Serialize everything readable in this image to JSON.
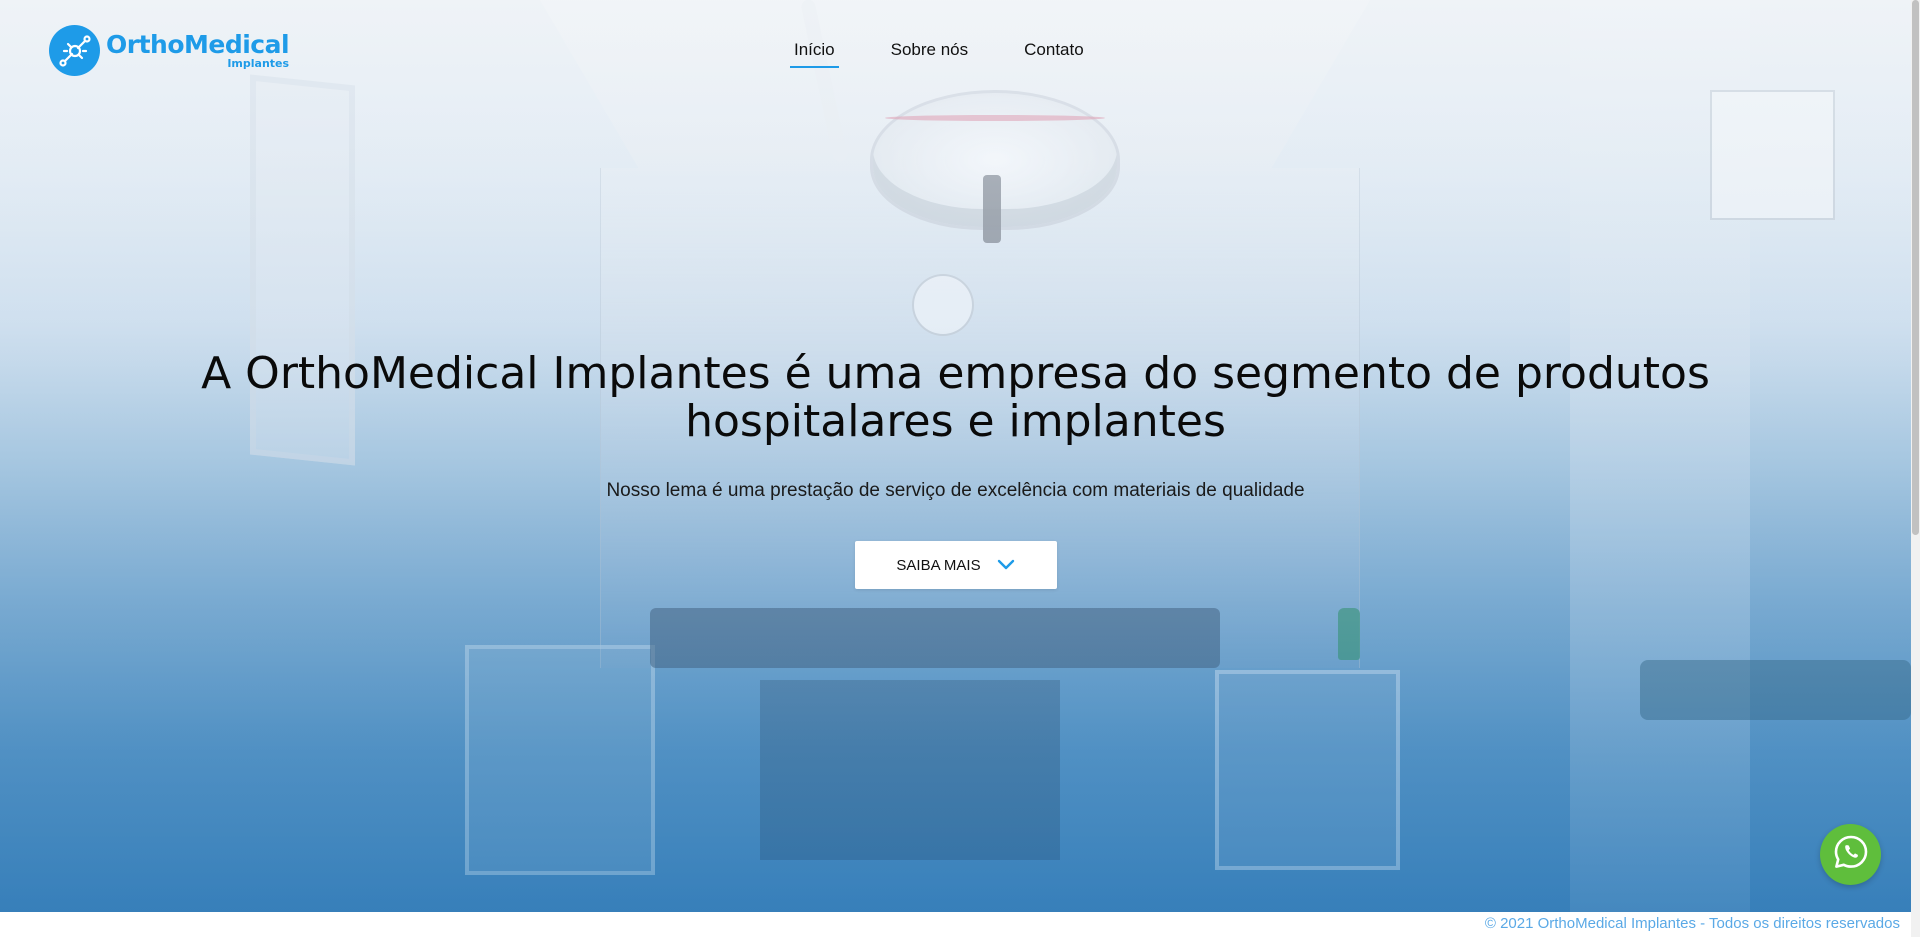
{
  "brand": {
    "name": "OrthoMedical",
    "sub": "Implantes",
    "color": "#1e9be8"
  },
  "nav": {
    "items": [
      {
        "label": "Início",
        "active": true
      },
      {
        "label": "Sobre nós",
        "active": false
      },
      {
        "label": "Contato",
        "active": false
      }
    ]
  },
  "hero": {
    "title": "A OrthoMedical Implantes é uma empresa do segmento de produtos hospitalares e implantes",
    "subtitle": "Nosso lema é uma prestação de serviço de excelência com materiais de qualidade",
    "cta_label": "SAIBA MAIS",
    "cta_icon": "chevron-down-icon"
  },
  "whatsapp": {
    "icon": "whatsapp-icon",
    "color": "#5fbe3c"
  },
  "footer": {
    "text": "© 2021 OrthoMedical Implantes - Todos os direitos reservados",
    "color": "#5aa9e6"
  }
}
